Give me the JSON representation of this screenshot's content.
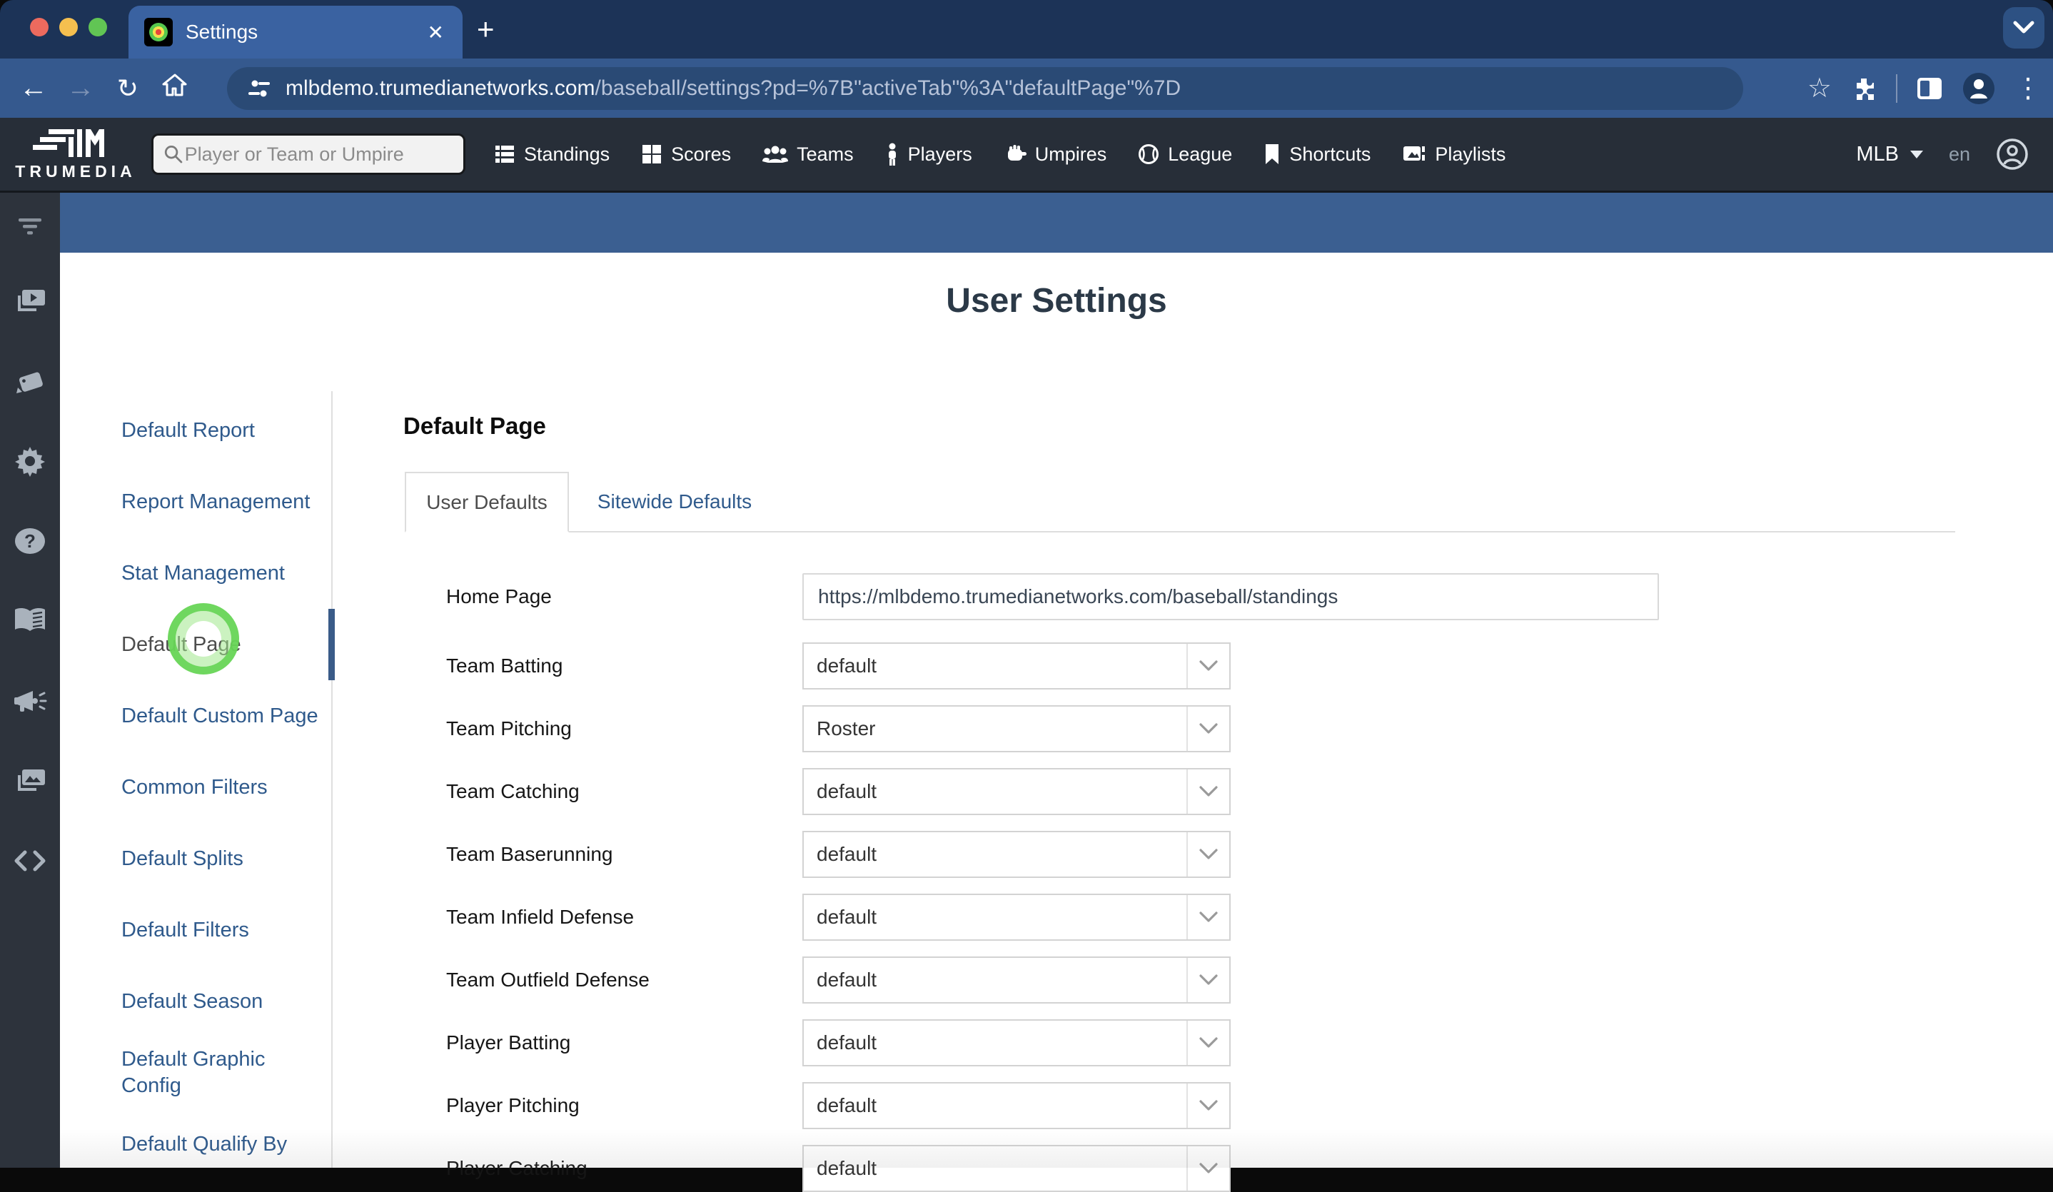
{
  "browser": {
    "tab_title": "Settings",
    "url_domain": "mlbdemo.trumedianetworks.com",
    "url_path": "/baseball/settings?pd=%7B\"activeTab\"%3A\"defaultPage\"%7D"
  },
  "header": {
    "logo_text": "TRUMEDIA",
    "search_placeholder": "Player or Team or Umpire",
    "nav": [
      {
        "label": "Standings"
      },
      {
        "label": "Scores"
      },
      {
        "label": "Teams"
      },
      {
        "label": "Players"
      },
      {
        "label": "Umpires"
      },
      {
        "label": "League"
      },
      {
        "label": "Shortcuts"
      },
      {
        "label": "Playlists"
      }
    ],
    "league": "MLB",
    "language": "en"
  },
  "rail": {
    "icons": [
      "filter",
      "video-playlists",
      "card-tag",
      "settings-gear",
      "help",
      "glossary-book",
      "announcements-megaphone",
      "media-gallery",
      "api-code"
    ]
  },
  "page": {
    "title": "User Settings"
  },
  "settings_nav": {
    "active": "Default Page",
    "items": [
      {
        "label": "Default Report"
      },
      {
        "label": "Report Management"
      },
      {
        "label": "Stat Management"
      },
      {
        "label": "Default Page"
      },
      {
        "label": "Default Custom Page"
      },
      {
        "label": "Common Filters"
      },
      {
        "label": "Default Splits"
      },
      {
        "label": "Default Filters"
      },
      {
        "label": "Default Season"
      },
      {
        "label": "Default Graphic Config"
      },
      {
        "label": "Default Qualify By"
      }
    ]
  },
  "main": {
    "section_heading": "Default Page",
    "tabs": [
      {
        "label": "User Defaults",
        "active": true
      },
      {
        "label": "Sitewide Defaults",
        "active": false
      }
    ],
    "form": {
      "rows": [
        {
          "label": "Home Page",
          "type": "input",
          "value": "https://mlbdemo.trumedianetworks.com/baseball/standings"
        },
        {
          "label": "Team Batting",
          "type": "select",
          "value": "default"
        },
        {
          "label": "Team Pitching",
          "type": "select",
          "value": "Roster"
        },
        {
          "label": "Team Catching",
          "type": "select",
          "value": "default"
        },
        {
          "label": "Team Baserunning",
          "type": "select",
          "value": "default"
        },
        {
          "label": "Team Infield Defense",
          "type": "select",
          "value": "default"
        },
        {
          "label": "Team Outfield Defense",
          "type": "select",
          "value": "default"
        },
        {
          "label": "Player Batting",
          "type": "select",
          "value": "default"
        },
        {
          "label": "Player Pitching",
          "type": "select",
          "value": "default"
        },
        {
          "label": "Player Catching",
          "type": "select",
          "value": "default"
        }
      ]
    }
  },
  "colors": {
    "accent_blue": "#3b5f91",
    "link_blue": "#2f5a8c",
    "header_dark": "#272e38",
    "click_ring_green": "#67d556"
  }
}
